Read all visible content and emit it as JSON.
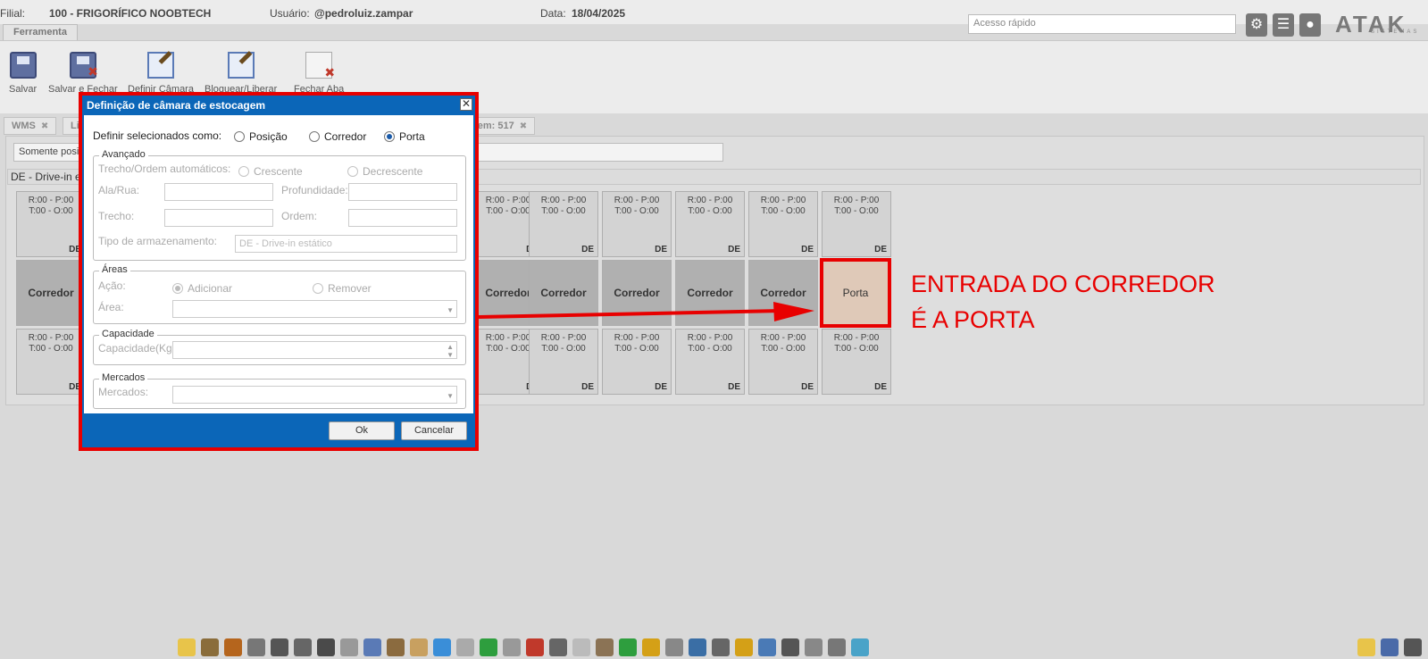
{
  "header": {
    "filial_label": "Filial:",
    "filial_value": "100 - FRIGORÍFICO NOOBTECH",
    "usuario_label": "Usuário:",
    "usuario_value": "@pedroluiz.zampar",
    "data_label": "Data:",
    "data_value": "18/04/2025",
    "quick_access_placeholder": "Acesso rápido",
    "logo": "ATAK",
    "logo_sub": "SISTEMAS"
  },
  "toolbar": {
    "tab": "Ferramenta",
    "buttons": [
      {
        "label": "Salvar",
        "icon": "floppy-disk-icon"
      },
      {
        "label": "Salvar e Fechar",
        "icon": "floppy-disk-close-icon"
      },
      {
        "label": "Definir Câmara",
        "icon": "edit-pen-icon"
      },
      {
        "label": "Bloquear/Liberar",
        "icon": "edit-pen-icon"
      },
      {
        "label": "Fechar Aba",
        "icon": "close-document-icon"
      }
    ]
  },
  "tabs": [
    {
      "label": "WMS"
    },
    {
      "label": "Li"
    },
    {
      "label": "gem: 517"
    }
  ],
  "filter_text": "Somente posi",
  "section_title": "DE - Drive-in e",
  "grid": {
    "cell_r": "R:00 - P:00",
    "cell_t": "T:00 - O:00",
    "cell_type": "DE",
    "corridor_label": "Corredor",
    "door_label": "Porta"
  },
  "annotation": {
    "line1": "ENTRADA DO CORREDOR",
    "line2": "É A PORTA"
  },
  "dialog": {
    "title": "Definição de câmara de estocagem",
    "define_label": "Definir selecionados como:",
    "options": [
      "Posição",
      "Corredor",
      "Porta"
    ],
    "selected": "Porta",
    "avancado": {
      "legend": "Avançado",
      "trecho_ordem_label": "Trecho/Ordem automáticos:",
      "crescente": "Crescente",
      "decrescente": "Decrescente",
      "ala_rua": "Ala/Rua:",
      "profundidade": "Profundidade:",
      "trecho": "Trecho:",
      "ordem": "Ordem:",
      "tipo_armazenamento": "Tipo de armazenamento:",
      "tipo_value": "DE - Drive-in estático"
    },
    "areas": {
      "legend": "Áreas",
      "acao": "Ação:",
      "adicionar": "Adicionar",
      "remover": "Remover",
      "area": "Área:"
    },
    "capacidade": {
      "legend": "Capacidade",
      "label": "Capacidade(Kg):"
    },
    "mercados": {
      "legend": "Mercados",
      "label": "Mercados:"
    },
    "ok": "Ok",
    "cancel": "Cancelar"
  },
  "colors": {
    "dialog_blue": "#0b66b8",
    "highlight_red": "#e80000",
    "door_fill": "#dfc9b8"
  }
}
